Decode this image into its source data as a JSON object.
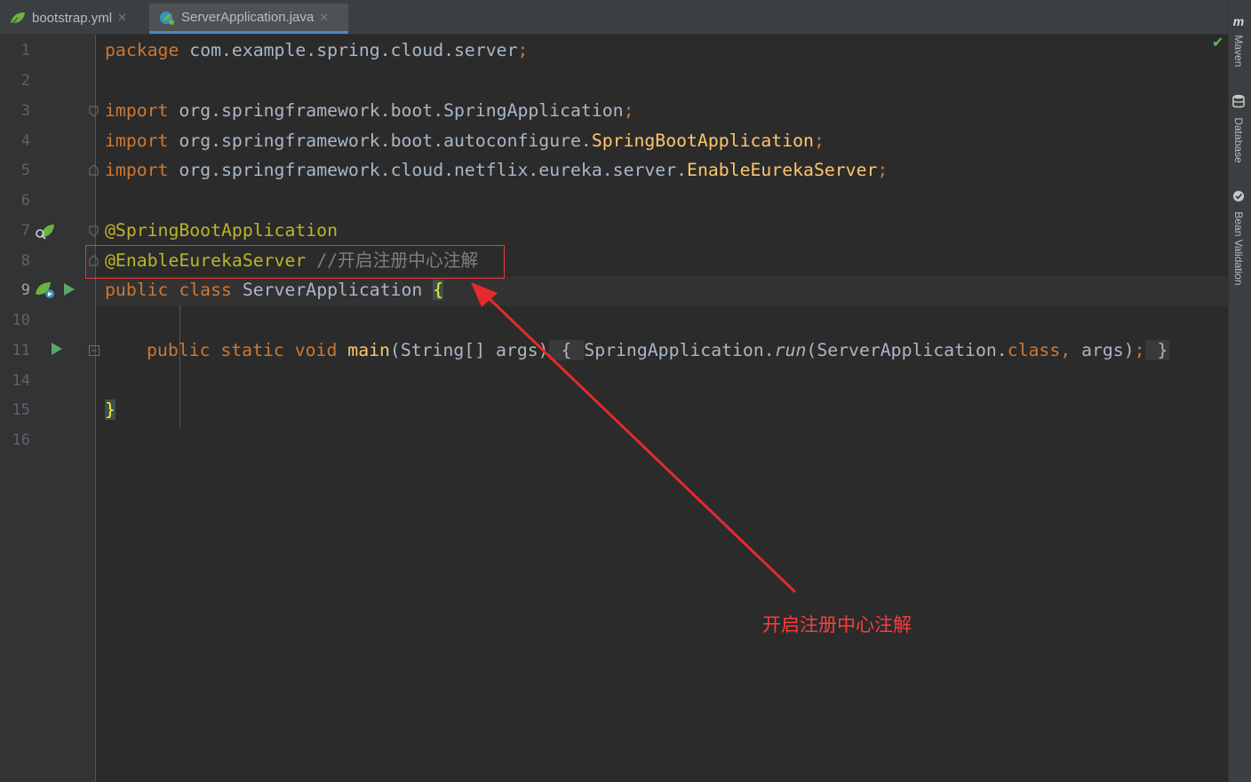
{
  "tabs": [
    {
      "label": "bootstrap.yml",
      "icon": "spring-leaf-icon",
      "active": false
    },
    {
      "label": "ServerApplication.java",
      "icon": "spring-boot-class-icon",
      "active": true
    }
  ],
  "right_tools": [
    "Maven",
    "Database",
    "Bean Validation"
  ],
  "line_numbers": [
    "1",
    "2",
    "3",
    "4",
    "5",
    "6",
    "7",
    "8",
    "9",
    "10",
    "11",
    "14",
    "15",
    "16"
  ],
  "current_line": "9",
  "code": {
    "l1_kw": "package",
    "l1_rest": " com.example.spring.cloud.server",
    "semi": ";",
    "import_kw": "import",
    "l3_rest": " org.springframework.boot.SpringApplication",
    "l4_pkg": " org.springframework.boot.autoconfigure.",
    "l4_cls": "SpringBootApplication",
    "l5_pkg": " org.springframework.cloud.netflix.eureka.server.",
    "l5_cls": "EnableEurekaServer",
    "l7_ann": "@SpringBootApplication",
    "l8_ann": "@EnableEurekaServer",
    "l8_comment": " //开启注册中心注解",
    "l9_kw": "public class",
    "l9_name": " ServerApplication ",
    "l9_brace": "{",
    "l11_kw": "public static void",
    "l11_fn": " main",
    "l11_params": "(String[] args)",
    "l11_open": " { ",
    "l11_cls": "SpringApplication.",
    "l11_run": "run",
    "l11_arg1": "(ServerApplication.",
    "l11_class_kw": "class",
    "l11_comma": ", ",
    "l11_args_end": "args)",
    "l11_close": " }",
    "l15_brace": "}"
  },
  "annotation_note": "开启注册中心注解",
  "colors": {
    "keyword": "#cc7832",
    "annotation": "#bbb529",
    "comment": "#808080",
    "text": "#a9b7c6",
    "method": "#ffc66d",
    "highlight": "#e03c3c"
  }
}
